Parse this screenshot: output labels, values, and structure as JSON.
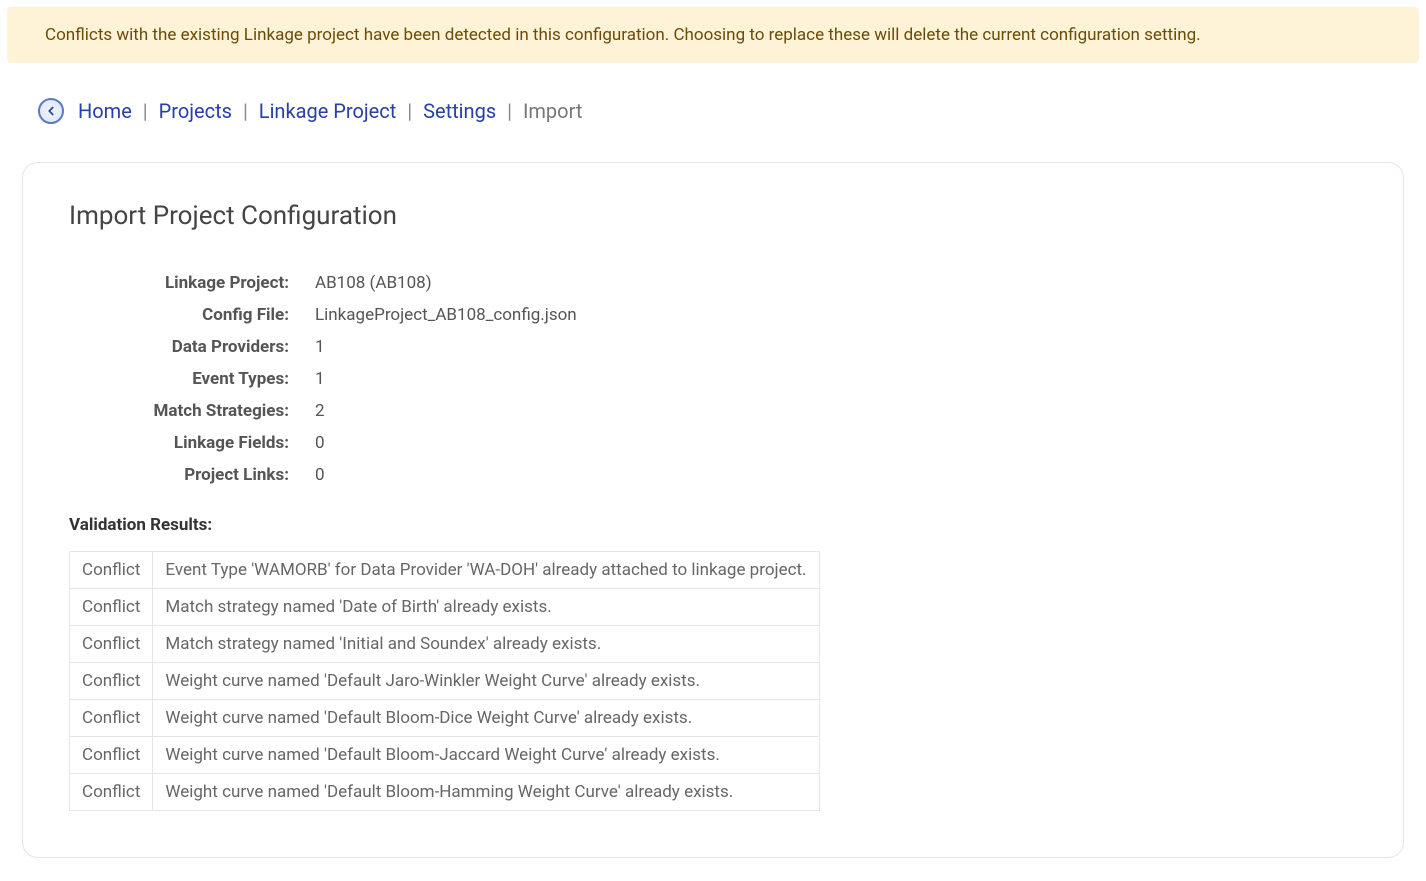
{
  "alert": {
    "text": "Conflicts with the existing Linkage project have been detected in this configuration. Choosing to replace these will delete the current configuration setting."
  },
  "breadcrumb": {
    "items": [
      {
        "label": "Home",
        "link": true
      },
      {
        "label": "Projects",
        "link": true
      },
      {
        "label": "Linkage Project",
        "link": true
      },
      {
        "label": "Settings",
        "link": true
      },
      {
        "label": "Import",
        "link": false
      }
    ]
  },
  "panel": {
    "title": "Import Project Configuration",
    "summary": [
      {
        "label": "Linkage Project:",
        "value": "AB108 (AB108)"
      },
      {
        "label": "Config File:",
        "value": "LinkageProject_AB108_config.json"
      },
      {
        "label": "Data Providers:",
        "value": "1"
      },
      {
        "label": "Event Types:",
        "value": "1"
      },
      {
        "label": "Match Strategies:",
        "value": "2"
      },
      {
        "label": "Linkage Fields:",
        "value": "0"
      },
      {
        "label": "Project Links:",
        "value": "0"
      }
    ],
    "results_heading": "Validation Results:",
    "results": [
      {
        "type": "Conflict",
        "message": "Event Type 'WAMORB' for Data Provider 'WA-DOH' already attached to linkage project."
      },
      {
        "type": "Conflict",
        "message": "Match strategy named 'Date of Birth' already exists."
      },
      {
        "type": "Conflict",
        "message": "Match strategy named 'Initial and Soundex' already exists."
      },
      {
        "type": "Conflict",
        "message": "Weight curve named 'Default Jaro-Winkler Weight Curve' already exists."
      },
      {
        "type": "Conflict",
        "message": "Weight curve named 'Default Bloom-Dice Weight Curve' already exists."
      },
      {
        "type": "Conflict",
        "message": "Weight curve named 'Default Bloom-Jaccard Weight Curve' already exists."
      },
      {
        "type": "Conflict",
        "message": "Weight curve named 'Default Bloom-Hamming Weight Curve' already exists."
      }
    ]
  }
}
